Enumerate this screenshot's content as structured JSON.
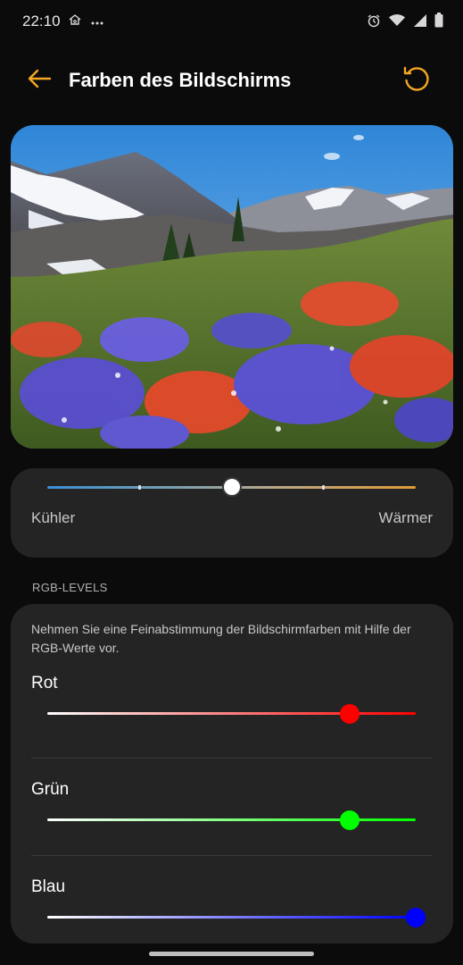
{
  "status_bar": {
    "time": "22:10",
    "left_icons": [
      "home-outline-icon",
      "more-dots-icon"
    ],
    "right_icons": [
      "alarm-icon",
      "wifi-icon",
      "signal-icon",
      "battery-icon"
    ]
  },
  "app_bar": {
    "title": "Farben des Bildschirms",
    "back_icon": "arrow-left-icon",
    "reset_icon": "reset-icon",
    "accent_color": "#f5a623"
  },
  "preview": {
    "subject": "mountain-wildflower-meadow"
  },
  "color_temperature": {
    "value": 0.5,
    "left_label": "Kühler",
    "right_label": "Wärmer"
  },
  "rgb_levels": {
    "section_title": "RGB-LEVELS",
    "description": "Nehmen Sie eine Feinabstimmung der Bildschirmfarben mit Hilfe der RGB-Werte vor.",
    "channels": [
      {
        "label": "Rot",
        "value": 0.82,
        "color": "#ff0000"
      },
      {
        "label": "Grün",
        "value": 0.82,
        "color": "#00ff00"
      },
      {
        "label": "Blau",
        "value": 1.0,
        "color": "#0000ff"
      }
    ]
  }
}
